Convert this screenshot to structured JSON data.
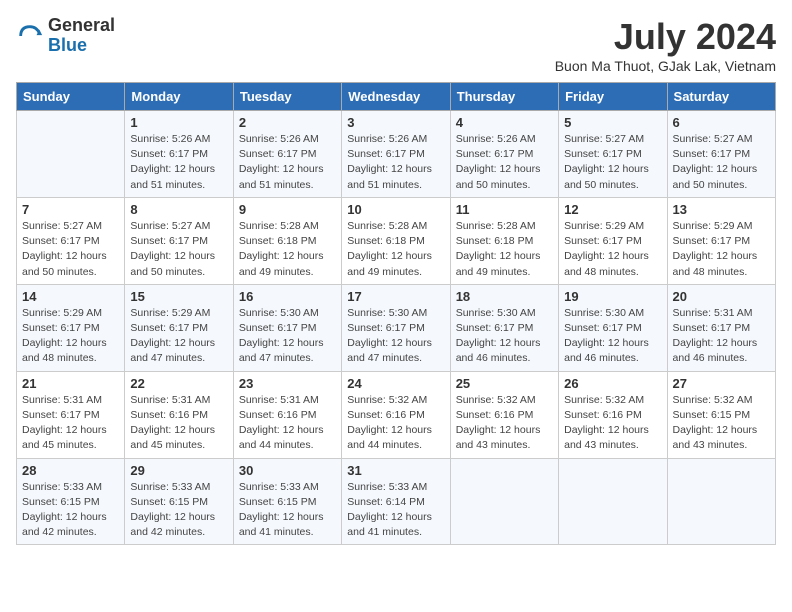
{
  "header": {
    "logo_general": "General",
    "logo_blue": "Blue",
    "title": "July 2024",
    "location": "Buon Ma Thuot, GJak Lak, Vietnam"
  },
  "days_of_week": [
    "Sunday",
    "Monday",
    "Tuesday",
    "Wednesday",
    "Thursday",
    "Friday",
    "Saturday"
  ],
  "weeks": [
    [
      {
        "num": "",
        "info": ""
      },
      {
        "num": "1",
        "info": "Sunrise: 5:26 AM\nSunset: 6:17 PM\nDaylight: 12 hours\nand 51 minutes."
      },
      {
        "num": "2",
        "info": "Sunrise: 5:26 AM\nSunset: 6:17 PM\nDaylight: 12 hours\nand 51 minutes."
      },
      {
        "num": "3",
        "info": "Sunrise: 5:26 AM\nSunset: 6:17 PM\nDaylight: 12 hours\nand 51 minutes."
      },
      {
        "num": "4",
        "info": "Sunrise: 5:26 AM\nSunset: 6:17 PM\nDaylight: 12 hours\nand 50 minutes."
      },
      {
        "num": "5",
        "info": "Sunrise: 5:27 AM\nSunset: 6:17 PM\nDaylight: 12 hours\nand 50 minutes."
      },
      {
        "num": "6",
        "info": "Sunrise: 5:27 AM\nSunset: 6:17 PM\nDaylight: 12 hours\nand 50 minutes."
      }
    ],
    [
      {
        "num": "7",
        "info": "Sunrise: 5:27 AM\nSunset: 6:17 PM\nDaylight: 12 hours\nand 50 minutes."
      },
      {
        "num": "8",
        "info": "Sunrise: 5:27 AM\nSunset: 6:17 PM\nDaylight: 12 hours\nand 50 minutes."
      },
      {
        "num": "9",
        "info": "Sunrise: 5:28 AM\nSunset: 6:18 PM\nDaylight: 12 hours\nand 49 minutes."
      },
      {
        "num": "10",
        "info": "Sunrise: 5:28 AM\nSunset: 6:18 PM\nDaylight: 12 hours\nand 49 minutes."
      },
      {
        "num": "11",
        "info": "Sunrise: 5:28 AM\nSunset: 6:18 PM\nDaylight: 12 hours\nand 49 minutes."
      },
      {
        "num": "12",
        "info": "Sunrise: 5:29 AM\nSunset: 6:17 PM\nDaylight: 12 hours\nand 48 minutes."
      },
      {
        "num": "13",
        "info": "Sunrise: 5:29 AM\nSunset: 6:17 PM\nDaylight: 12 hours\nand 48 minutes."
      }
    ],
    [
      {
        "num": "14",
        "info": "Sunrise: 5:29 AM\nSunset: 6:17 PM\nDaylight: 12 hours\nand 48 minutes."
      },
      {
        "num": "15",
        "info": "Sunrise: 5:29 AM\nSunset: 6:17 PM\nDaylight: 12 hours\nand 47 minutes."
      },
      {
        "num": "16",
        "info": "Sunrise: 5:30 AM\nSunset: 6:17 PM\nDaylight: 12 hours\nand 47 minutes."
      },
      {
        "num": "17",
        "info": "Sunrise: 5:30 AM\nSunset: 6:17 PM\nDaylight: 12 hours\nand 47 minutes."
      },
      {
        "num": "18",
        "info": "Sunrise: 5:30 AM\nSunset: 6:17 PM\nDaylight: 12 hours\nand 46 minutes."
      },
      {
        "num": "19",
        "info": "Sunrise: 5:30 AM\nSunset: 6:17 PM\nDaylight: 12 hours\nand 46 minutes."
      },
      {
        "num": "20",
        "info": "Sunrise: 5:31 AM\nSunset: 6:17 PM\nDaylight: 12 hours\nand 46 minutes."
      }
    ],
    [
      {
        "num": "21",
        "info": "Sunrise: 5:31 AM\nSunset: 6:17 PM\nDaylight: 12 hours\nand 45 minutes."
      },
      {
        "num": "22",
        "info": "Sunrise: 5:31 AM\nSunset: 6:16 PM\nDaylight: 12 hours\nand 45 minutes."
      },
      {
        "num": "23",
        "info": "Sunrise: 5:31 AM\nSunset: 6:16 PM\nDaylight: 12 hours\nand 44 minutes."
      },
      {
        "num": "24",
        "info": "Sunrise: 5:32 AM\nSunset: 6:16 PM\nDaylight: 12 hours\nand 44 minutes."
      },
      {
        "num": "25",
        "info": "Sunrise: 5:32 AM\nSunset: 6:16 PM\nDaylight: 12 hours\nand 43 minutes."
      },
      {
        "num": "26",
        "info": "Sunrise: 5:32 AM\nSunset: 6:16 PM\nDaylight: 12 hours\nand 43 minutes."
      },
      {
        "num": "27",
        "info": "Sunrise: 5:32 AM\nSunset: 6:15 PM\nDaylight: 12 hours\nand 43 minutes."
      }
    ],
    [
      {
        "num": "28",
        "info": "Sunrise: 5:33 AM\nSunset: 6:15 PM\nDaylight: 12 hours\nand 42 minutes."
      },
      {
        "num": "29",
        "info": "Sunrise: 5:33 AM\nSunset: 6:15 PM\nDaylight: 12 hours\nand 42 minutes."
      },
      {
        "num": "30",
        "info": "Sunrise: 5:33 AM\nSunset: 6:15 PM\nDaylight: 12 hours\nand 41 minutes."
      },
      {
        "num": "31",
        "info": "Sunrise: 5:33 AM\nSunset: 6:14 PM\nDaylight: 12 hours\nand 41 minutes."
      },
      {
        "num": "",
        "info": ""
      },
      {
        "num": "",
        "info": ""
      },
      {
        "num": "",
        "info": ""
      }
    ]
  ]
}
